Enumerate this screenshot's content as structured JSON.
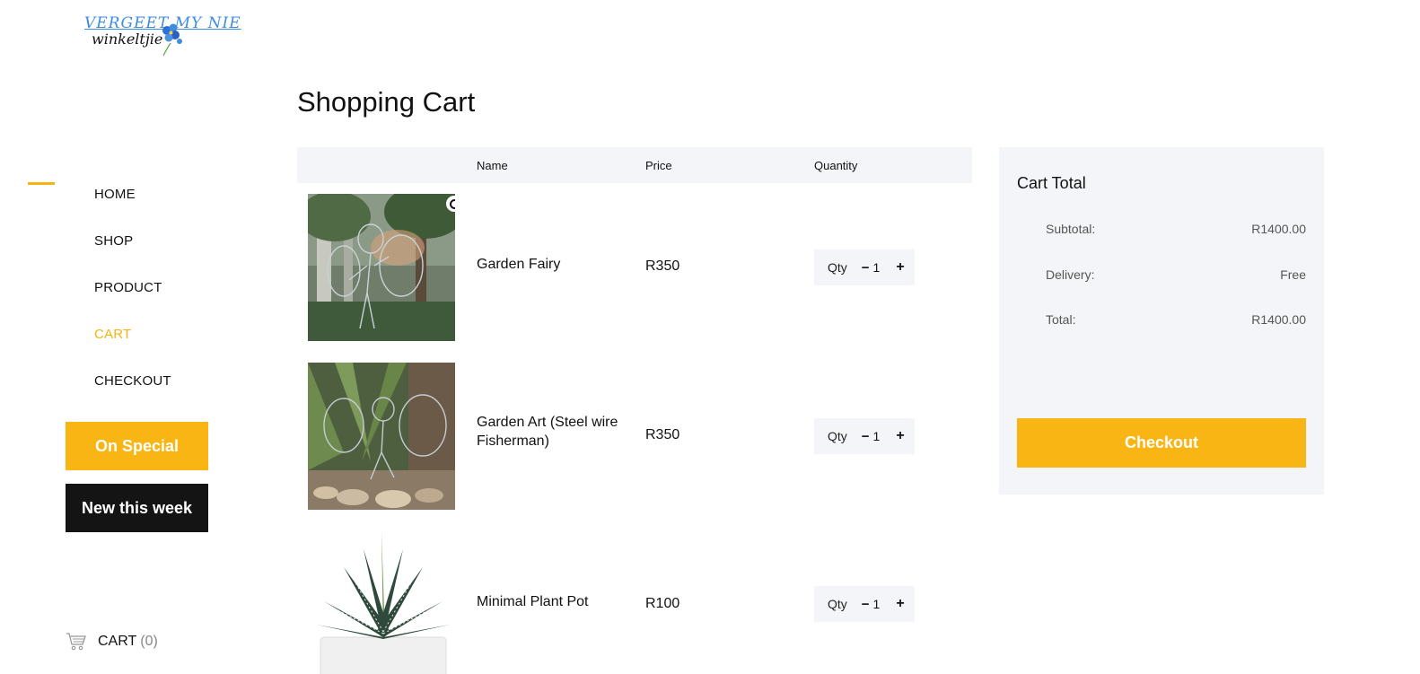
{
  "logo": {
    "line1": "VERGEET MY NIE",
    "line2": "winkeltjie"
  },
  "nav": {
    "items": [
      {
        "label": "HOME",
        "active": false
      },
      {
        "label": "SHOP",
        "active": false
      },
      {
        "label": "PRODUCT",
        "active": false
      },
      {
        "label": "CART",
        "active": true
      },
      {
        "label": "CHECKOUT",
        "active": false
      }
    ],
    "special_label": "On Special",
    "new_label": "New this week",
    "cart_label": "CART",
    "cart_count": "(0)"
  },
  "page": {
    "title": "Shopping Cart"
  },
  "table": {
    "headers": {
      "name": "Name",
      "price": "Price",
      "quantity": "Quantity"
    },
    "rows": [
      {
        "name": "Garden Fairy",
        "price": "R350",
        "qty_label": "Qty",
        "minus": "−",
        "qty": "1",
        "plus": "+"
      },
      {
        "name": "Garden Art (Steel wire Fisherman)",
        "price": "R350",
        "qty_label": "Qty",
        "minus": "−",
        "qty": "1",
        "plus": "+"
      },
      {
        "name": "Minimal Plant Pot",
        "price": "R100",
        "qty_label": "Qty",
        "minus": "−",
        "qty": "1",
        "plus": "+"
      }
    ]
  },
  "totals": {
    "title": "Cart Total",
    "subtotal_label": "Subtotal:",
    "subtotal_value": "R1400.00",
    "delivery_label": "Delivery:",
    "delivery_value": "Free",
    "total_label": "Total:",
    "total_value": "R1400.00",
    "checkout_label": "Checkout"
  },
  "colors": {
    "accent": "#f9b514",
    "panel": "#f4f5f8",
    "dark": "#141414"
  },
  "icons": {
    "remove": "remove-item-icon",
    "cart": "cart-icon",
    "logo_flower": "forget-me-not-flower-icon"
  }
}
